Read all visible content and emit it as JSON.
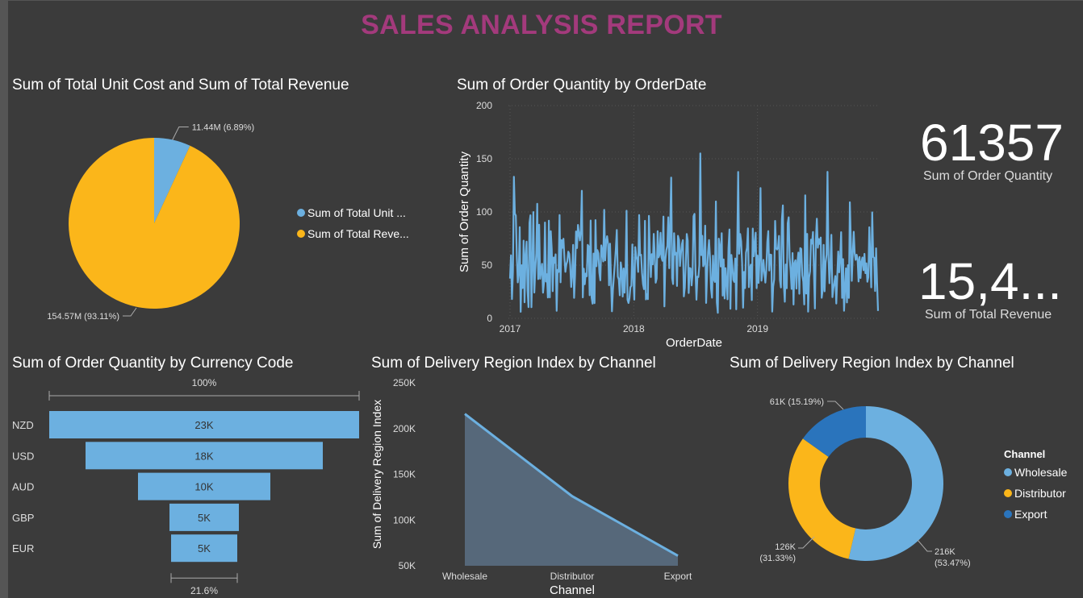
{
  "report": {
    "title": "SALES ANALYSIS REPORT"
  },
  "colors": {
    "blue": "#6cb0e0",
    "orange": "#fbb61a",
    "darkblue": "#2a74bc",
    "title": "#a33a7c"
  },
  "pie": {
    "title": "Sum of Total Unit Cost and Sum of Total Revenue",
    "legend": [
      "Sum of Total Unit ...",
      "Sum of Total Reve..."
    ],
    "labels": [
      "11.44M (6.89%)",
      "154.57M (93.11%)"
    ]
  },
  "line": {
    "title": "Sum of Order Quantity by OrderDate",
    "ylabel": "Sum of Order Quantity",
    "xlabel": "OrderDate",
    "yticks": [
      "200",
      "150",
      "100",
      "50",
      "0"
    ],
    "xticks": [
      "2017",
      "2018",
      "2019"
    ]
  },
  "cards": {
    "quantity": {
      "value": "61357",
      "label": "Sum of Order Quantity"
    },
    "revenue": {
      "value": "15,4...",
      "label": "Sum of Total Revenue"
    }
  },
  "funnel": {
    "title": "Sum of Order Quantity by Currency Code",
    "top_label": "100%",
    "bottom_label": "21.6%"
  },
  "area": {
    "title": "Sum of Delivery Region Index by Channel",
    "ylabel": "Sum of Delivery Region Index",
    "xlabel": "Channel",
    "yticks": [
      "250K",
      "200K",
      "150K",
      "100K",
      "50K"
    ]
  },
  "donut": {
    "title": "Sum of Delivery Region Index by Channel",
    "legend_title": "Channel",
    "labels": {
      "export": "61K (15.19%)",
      "distributor_value": "126K",
      "distributor_pct": "(31.33%)",
      "wholesale_value": "216K",
      "wholesale_pct": "(53.47%)"
    }
  },
  "chart_data": [
    {
      "type": "pie",
      "title": "Sum of Total Unit Cost and Sum of Total Revenue",
      "categories": [
        "Sum of Total Unit Cost",
        "Sum of Total Revenue"
      ],
      "values": [
        11.44,
        154.57
      ],
      "unit": "M",
      "percents": [
        6.89,
        93.11
      ],
      "legend": "right"
    },
    {
      "type": "line",
      "title": "Sum of Order Quantity by OrderDate",
      "xlabel": "OrderDate",
      "ylabel": "Sum of Order Quantity",
      "ylim": [
        0,
        200
      ],
      "xlim": [
        "2017-01-01",
        "2019-12-31"
      ],
      "x_ticks": [
        "2017",
        "2018",
        "2019"
      ],
      "grid": true,
      "series": [
        {
          "values": [
            38,
            55,
            45,
            62,
            48,
            35,
            70,
            52,
            40,
            58,
            66,
            44,
            50,
            47,
            61,
            39,
            56,
            73,
            49,
            42,
            59,
            64,
            37,
            53,
            68,
            46,
            51,
            57,
            43,
            60,
            54,
            41,
            63,
            48,
            36,
            58,
            71,
            45,
            52,
            49,
            62,
            38,
            55,
            67,
            44,
            50,
            59,
            42,
            57,
            65,
            47,
            53,
            40,
            61,
            56,
            43,
            69,
            48,
            51,
            58,
            39,
            64,
            54,
            46,
            60,
            52,
            45,
            57,
            63,
            41,
            55,
            50,
            48,
            66,
            44,
            53,
            59,
            42,
            62,
            47,
            56,
            51,
            38,
            60,
            54,
            49,
            65,
            43,
            58,
            52
          ]
        }
      ]
    },
    {
      "type": "funnel",
      "title": "Sum of Order Quantity by Currency Code",
      "categories": [
        "NZD",
        "USD",
        "AUD",
        "GBP",
        "EUR"
      ],
      "values": [
        23000,
        18000,
        10000,
        5000,
        5000
      ],
      "value_labels": [
        "23K",
        "18K",
        "10K",
        "5K",
        "5K"
      ],
      "top_percent": "100%",
      "bottom_percent": "21.6%"
    },
    {
      "type": "area",
      "title": "Sum of Delivery Region Index by Channel",
      "categories": [
        "Wholesale",
        "Distributor",
        "Export"
      ],
      "values": [
        216000,
        126000,
        61000
      ],
      "xlabel": "Channel",
      "ylabel": "Sum of Delivery Region Index",
      "ylim": [
        50000,
        250000
      ]
    },
    {
      "type": "donut",
      "title": "Sum of Delivery Region Index by Channel",
      "legend_title": "Channel",
      "categories": [
        "Wholesale",
        "Distributor",
        "Export"
      ],
      "values": [
        216000,
        126000,
        61000
      ],
      "percents": [
        53.47,
        31.33,
        15.19
      ],
      "legend": "right"
    }
  ]
}
